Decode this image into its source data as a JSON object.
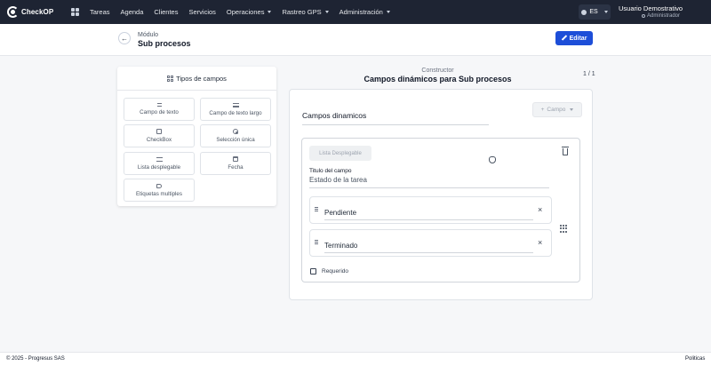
{
  "app": {
    "name": "CheckOP"
  },
  "nav": {
    "items": [
      {
        "label": "Tareas",
        "dropdown": false
      },
      {
        "label": "Agenda",
        "dropdown": false
      },
      {
        "label": "Clientes",
        "dropdown": false
      },
      {
        "label": "Servicios",
        "dropdown": false
      },
      {
        "label": "Operaciones",
        "dropdown": true
      },
      {
        "label": "Rastreo GPS",
        "dropdown": true
      },
      {
        "label": "Administración",
        "dropdown": true
      }
    ],
    "language": "ES",
    "user": {
      "name": "Usuario Demostrativo",
      "role": "Administrador"
    }
  },
  "header": {
    "module_label": "Módulo",
    "title": "Sub procesos",
    "edit_label": "Editar"
  },
  "field_types": {
    "title": "Tipos de campos",
    "items": [
      {
        "label": "Campo de texto",
        "icon": "text-lines-icon"
      },
      {
        "label": "Campo de texto largo",
        "icon": "long-text-icon"
      },
      {
        "label": "CheckBox",
        "icon": "checkbox-icon"
      },
      {
        "label": "Selección única",
        "icon": "radio-icon"
      },
      {
        "label": "Lista desplegable",
        "icon": "list-icon"
      },
      {
        "label": "Fecha",
        "icon": "calendar-icon"
      },
      {
        "label": "Etiquetas multiples",
        "icon": "tag-icon"
      }
    ]
  },
  "builder": {
    "subtitle": "Constructor",
    "title": "Campos dinámicos para Sub procesos",
    "pager": "1 / 1",
    "section_title": "Campos dinamicos",
    "add_field_label": "Campo",
    "field": {
      "type_chip": "Lista Desplegable",
      "title_label": "Titulo del campo",
      "title_value": "Estado de la tarea",
      "options": [
        "Pendiente",
        "Terminado"
      ],
      "required_label": "Requerido"
    }
  },
  "footer": {
    "copyright": "© 2025 - Progresus SAS",
    "policies": "Politicas"
  }
}
